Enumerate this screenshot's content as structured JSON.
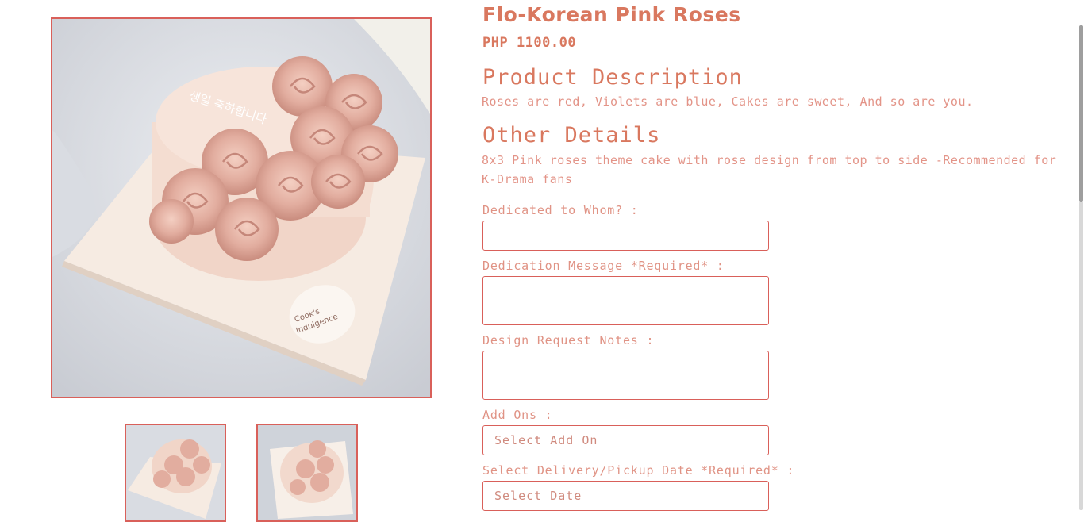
{
  "product": {
    "title": "Flo-Korean Pink Roses",
    "price": "PHP 1100.00",
    "description_heading": "Product Description",
    "description": "Roses are red, Violets are blue, Cakes are sweet, And so are you.",
    "details_heading": "Other Details",
    "details": "8x3 Pink roses theme cake with rose design from top to side -Recommended for K-Drama fans"
  },
  "form": {
    "dedicated_label": "Dedicated to Whom? :",
    "dedicated_value": "",
    "message_label": "Dedication Message *Required* :",
    "message_value": "",
    "design_label": "Design Request Notes :",
    "design_value": "",
    "addons_label": "Add Ons :",
    "addons_selected": "Select Add On",
    "date_label": "Select Delivery/Pickup Date *Required* :",
    "date_selected": "Select Date"
  },
  "gallery": {
    "main_image": "cake-photo",
    "thumbnails": [
      "cake-photo-1",
      "cake-photo-2"
    ]
  },
  "colors": {
    "accent": "#d9785f",
    "border": "#d9605a",
    "text_light": "#e39488"
  }
}
